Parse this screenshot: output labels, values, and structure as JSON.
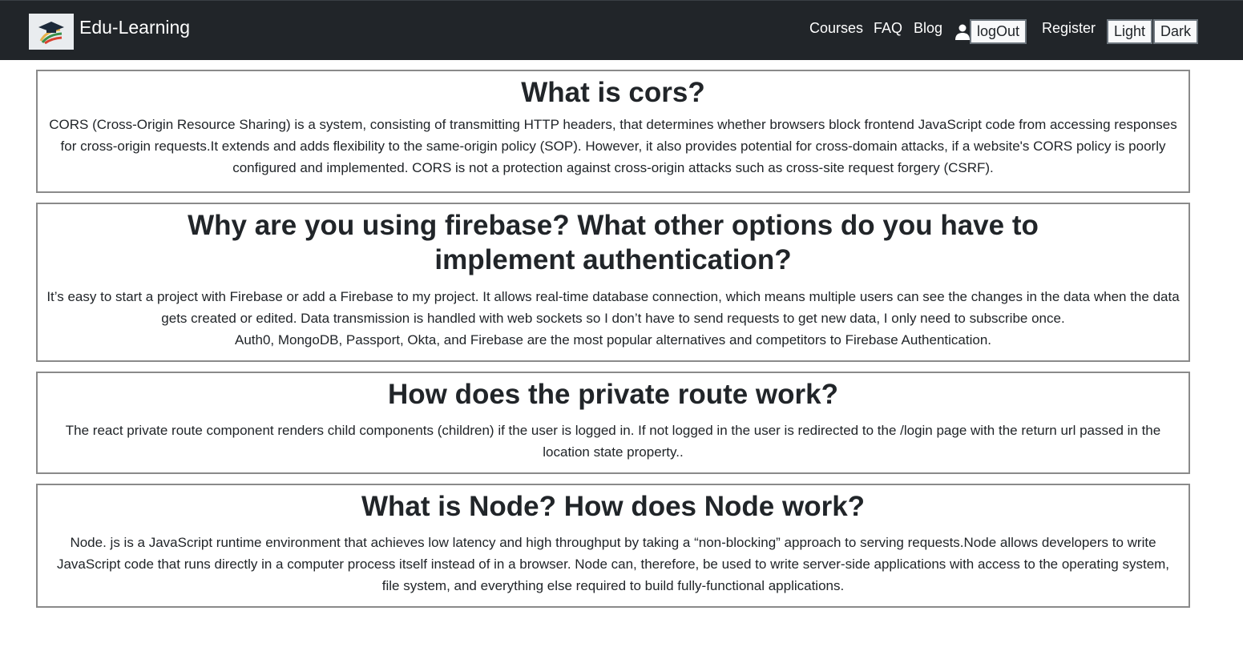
{
  "navbar": {
    "brand": "Edu-Learning",
    "links": [
      "Courses",
      "FAQ",
      "Blog"
    ],
    "logout_label": "logOut",
    "register_label": "Register",
    "light_label": "Light",
    "dark_label": "Dark"
  },
  "faq": [
    {
      "question": "What is cors?",
      "answer": "CORS (Cross-Origin Resource Sharing) is a system, consisting of transmitting HTTP headers, that determines whether browsers block frontend JavaScript code from accessing responses for cross-origin requests.It extends and adds flexibility to the same-origin policy (SOP). However, it also provides potential for cross-domain attacks, if a website's CORS policy is poorly configured and implemented. CORS is not a protection against cross-origin attacks such as cross-site request forgery (CSRF)."
    },
    {
      "question": "Why are you using firebase? What other options do you have to implement authentication?",
      "answer": "It’s easy to start a project with Firebase or add a Firebase to my project. It allows real-time database connection, which means multiple users can see the changes in the data when the data gets created or edited. Data transmission is handled with web sockets so I don’t have to send requests to get new data, I only need to subscribe once.",
      "answer2": "Auth0, MongoDB, Passport, Okta, and Firebase are the most popular alternatives and competitors to Firebase Authentication."
    },
    {
      "question": "How does the private route work?",
      "answer": "The react private route component renders child components (children) if the user is logged in. If not logged in the user is redirected to the /login page with the return url passed in the location state property.."
    },
    {
      "question": "What is Node? How does Node work?",
      "answer": "Node. js is a JavaScript runtime environment that achieves low latency and high throughput by taking a “non-blocking” approach to serving requests.Node allows developers to write JavaScript code that runs directly in a computer process itself instead of in a browser. Node can, therefore, be used to write server-side applications with access to the operating system, file system, and everything else required to build fully-functional applications."
    }
  ]
}
